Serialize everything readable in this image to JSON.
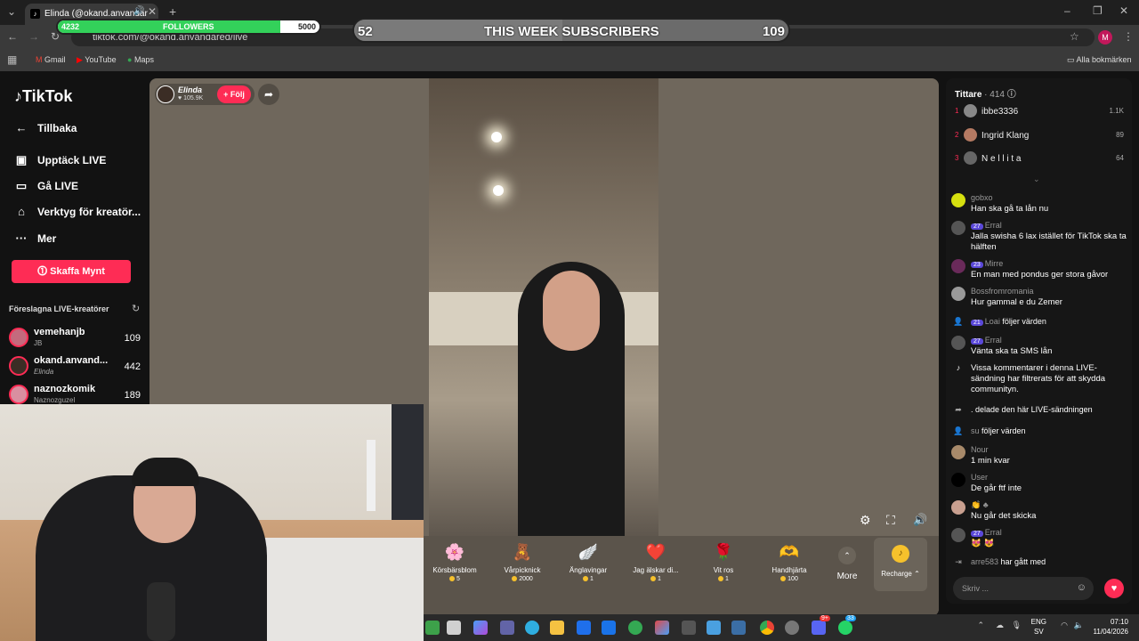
{
  "browser": {
    "tab_title": "Elinda (@okand.anvandar",
    "url": "tiktok.com/@okand.anvandared/live",
    "profile_initial": "M",
    "bookmarks": [
      "Gmail",
      "YouTube",
      "Maps"
    ],
    "all_bookmarks": "Alla bokmärken"
  },
  "overlay": {
    "followers": {
      "current": "4232",
      "label": "FOLLOWERS",
      "goal": "5000",
      "progress": 0.85
    },
    "subscribers": {
      "current": "52",
      "label": "THIS WEEK SUBSCRIBERS",
      "goal": "109",
      "progress": 0.48
    }
  },
  "sidebar": {
    "logo": "TikTok",
    "back": "Tillbaka",
    "nav": [
      "Upptäck LIVE",
      "Gå LIVE",
      "Verktyg för kreatör...",
      "Mer"
    ],
    "coins_button": "Skaffa Mynt",
    "suggested_title": "Föreslagna LIVE-kreatörer",
    "creators": [
      {
        "name": "vemehanjb",
        "sub": "JB",
        "count": "109"
      },
      {
        "name": "okand.anvand...",
        "sub": "Elinda",
        "count": "442"
      },
      {
        "name": "naznozkomik",
        "sub": "Naznozguzel",
        "count": "189"
      }
    ]
  },
  "stream": {
    "host_name": "Elinda",
    "host_likes": "105.9K",
    "follow_label": "+ Följ",
    "gifts": [
      {
        "name": "Körsbärsblom",
        "price": "5",
        "icon": "🌸"
      },
      {
        "name": "Vårpicknick",
        "price": "2000",
        "icon": "🧸"
      },
      {
        "name": "Änglavingar",
        "price": "1",
        "icon": "🪽"
      },
      {
        "name": "Jag älskar di...",
        "price": "1",
        "icon": "❤️"
      },
      {
        "name": "Vit ros",
        "price": "1",
        "icon": "🌹"
      },
      {
        "name": "Handhjärta",
        "price": "100",
        "icon": "🫶"
      }
    ],
    "more_label": "More",
    "recharge_label": "Recharge"
  },
  "chat": {
    "viewers_label": "Tittare",
    "viewers_count": "· 414",
    "top_viewers": [
      {
        "rank": "1",
        "name": "ibbe3336",
        "score": "1.1K"
      },
      {
        "rank": "2",
        "name": "Ingrid Klang",
        "score": "89"
      },
      {
        "rank": "3",
        "name": "N e l l i t a",
        "score": "64"
      }
    ],
    "messages": [
      {
        "user": "gobxo",
        "badge": "",
        "text": "Han ska gå ta lån nu"
      },
      {
        "user": "Erral",
        "badge": "27",
        "text": "Jalla swisha 6 lax istället för TikTok ska ta hälften"
      },
      {
        "user": "Mirre",
        "badge": "23",
        "text": "En man med pondus ger stora gåvor"
      },
      {
        "user": "Bossfromromania",
        "badge": "",
        "text": "Hur gammal e du Zemer"
      },
      {
        "user": "Loai",
        "badge": "21",
        "text": "följer värden"
      },
      {
        "user": "Erral",
        "badge": "27",
        "text": "Vänta ska ta SMS lån"
      },
      {
        "user": "",
        "badge": "",
        "text": "Vissa kommentarer i denna LIVE-sändning har filtrerats för att skydda communityn."
      },
      {
        "user": ".",
        "badge": "",
        "text": "delade den här LIVE-sändningen"
      },
      {
        "user": "su",
        "badge": "",
        "text": "följer värden"
      },
      {
        "user": "Nour",
        "badge": "",
        "text": "1 min kvar"
      },
      {
        "user": "User",
        "badge": "",
        "text": "De går ftf inte"
      },
      {
        "user": "",
        "badge": "",
        "text": "Nu går det skicka"
      },
      {
        "user": "Erral",
        "badge": "27",
        "text": ""
      },
      {
        "user": "arre583",
        "badge": "",
        "text": "har gått med"
      }
    ],
    "input_placeholder": "Skriv ..."
  },
  "taskbar": {
    "lang_top": "ENG",
    "lang_bottom": "SV",
    "time": "07:10",
    "date": "11/04/2026",
    "discord_badge": "9+",
    "whatsapp_badge": "33"
  }
}
